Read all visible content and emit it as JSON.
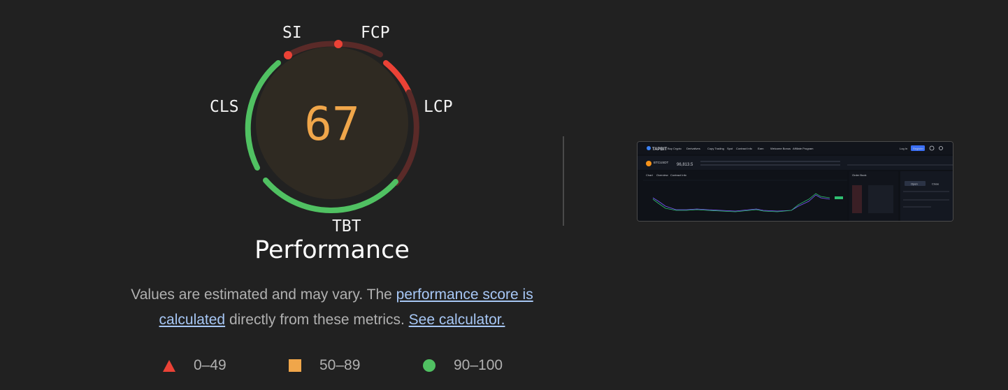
{
  "gauge": {
    "score": "67",
    "title": "Performance",
    "metrics": {
      "si": "SI",
      "fcp": "FCP",
      "lcp": "LCP",
      "tbt": "TBT",
      "cls": "CLS"
    },
    "score_fraction": 0.67,
    "colors": {
      "score": "#f0a64a",
      "fail": "#eb4236",
      "pass": "#50c162",
      "fail_track": "#5a2a28",
      "average": "#f0a64a",
      "inner_fill": "#2f2a22"
    }
  },
  "description": {
    "text_before": "Values are estimated and may vary. The ",
    "link_score": "performance score is calculated",
    "text_middle": " directly from these metrics. ",
    "link_calculator": "See calculator."
  },
  "legend": {
    "fail": "0–49",
    "average": "50–89",
    "pass": "90–100"
  },
  "thumbnail": {
    "brand": "TAPBIT",
    "nav": [
      "Buy Crypto",
      "Derivatives",
      "Copy Trading",
      "Spot",
      "Contract Info",
      "Earn",
      "Welcome Bonus",
      "Affiliate Program"
    ],
    "login": "Log In",
    "register": "Register",
    "pair": "BTCUSDT",
    "price": "96,813.5",
    "tabs": [
      "Chart",
      "Overview",
      "Contract Info"
    ],
    "order_book": "Order Book",
    "order_tabs": [
      "Open",
      "Close"
    ]
  }
}
